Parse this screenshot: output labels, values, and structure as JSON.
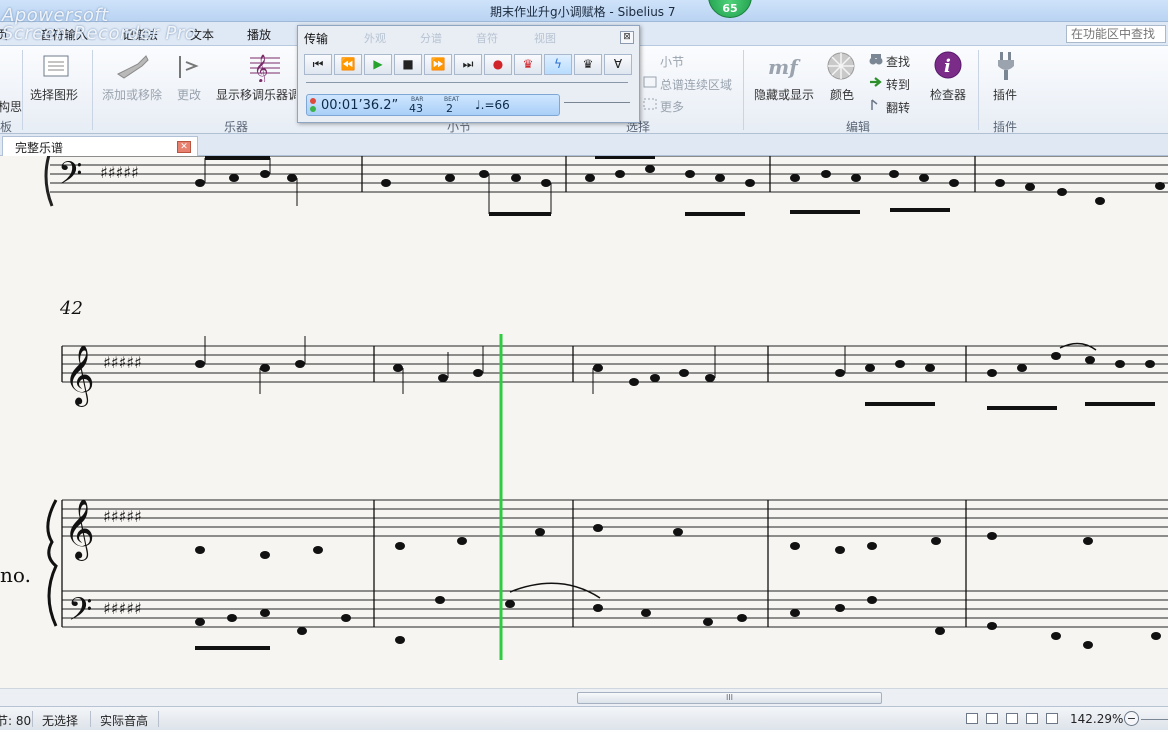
{
  "window": {
    "title": "期末作业升g小调赋格 - Sibelius 7",
    "badge_value": "65",
    "watermark_line1": "Apowersoft",
    "watermark_line2": "Screen Recorder Pro"
  },
  "ribbon_tabs": [
    "页",
    "音符输入",
    "记谱法",
    "文本",
    "播放"
  ],
  "ribbon_search_placeholder": "在功能区中查找",
  "ribbon": {
    "left_partial": "构思",
    "left_group_partial": "板",
    "select_graphic": "选择图形",
    "add_remove": "添加或移除",
    "change": "更改",
    "show_transposed": "显示移调乐器调",
    "instruments_group": "乐器",
    "bar_item": "小节",
    "system_passage": "总谱连续区域",
    "more": "更多",
    "bars_group": "小节",
    "selection_group": "选择",
    "hide_show": "隐藏或显示",
    "color": "颜色",
    "find": "查找",
    "goto": "转到",
    "flip": "翻转",
    "inspector": "检查器",
    "edit_group": "编辑",
    "plugins": "插件",
    "plugins_group": "插件"
  },
  "transport": {
    "title": "传输",
    "tabs": [
      "外观",
      "分谱",
      "音符",
      "视图"
    ],
    "close": "⊠",
    "buttons": [
      "⏮",
      "⏪",
      "▶",
      "■",
      "⏩",
      "⏭",
      "●",
      "♛",
      "ϟ",
      "♛",
      "Ɐ"
    ],
    "time": "00:01’36.2”",
    "bar_label": "BAR",
    "bar_value": "43",
    "beat_label": "BEAT",
    "beat_value": "2",
    "tempo": "♩.=66",
    "position_fraction": 0.53,
    "volume_fraction": 0.62
  },
  "document_tab": {
    "label": "完整乐谱",
    "close": "✕"
  },
  "score": {
    "bar_number": "42",
    "instrument_label_partial": "no."
  },
  "scrollbar_grip": "III",
  "status": {
    "bar_partial": "节: 80",
    "selection": "无选择",
    "pitch": "实际音高",
    "zoom": "142.29%",
    "zoom_minus": "−"
  },
  "colors": {
    "playline": "#2ecc40",
    "staff_line": "#222222",
    "paper": "#f7f5f1",
    "ribbon_bg": "#eef2f7"
  }
}
